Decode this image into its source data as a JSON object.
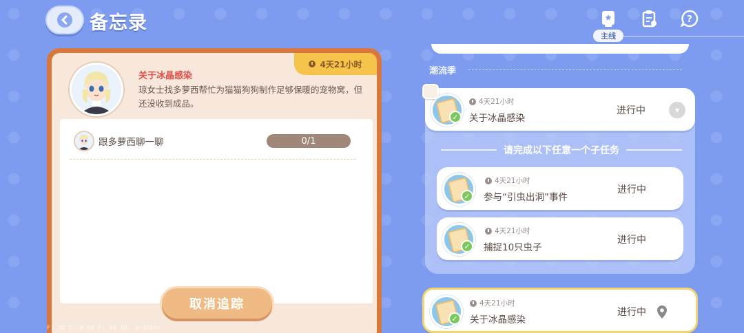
{
  "header": {
    "title": "备忘录",
    "tabs": [
      {
        "icon": "main-quest-icon",
        "label": "主线"
      },
      {
        "icon": "clipboard-icon"
      },
      {
        "icon": "help-icon"
      }
    ]
  },
  "detail": {
    "time_remaining": "4天21小时",
    "quest_title": "关于冰晶感染",
    "quest_desc": "琼女士找多萝西帮忙为猫猫狗狗制作足够保暖的宠物窝，但还没收到成品。",
    "sub_task": {
      "label": "跟多萝西聊一聊",
      "progress": "0/1"
    },
    "untrack_button": "取消追踪"
  },
  "debug_text": "F: 30   T: 0.00   P: 44   ID: qc6h34n",
  "list": {
    "section_title": "潮流季",
    "group": {
      "main": {
        "time": "4天21小时",
        "name": "关于冰晶感染",
        "status": "进行中"
      },
      "subheader": "请完成以下任意一个子任务",
      "subtasks": [
        {
          "time": "4天21小时",
          "name": "参与“引虫出洞”事件",
          "status": "进行中"
        },
        {
          "time": "4天21小时",
          "name": "捕捉10只虫子",
          "status": "进行中"
        }
      ]
    },
    "tracked": {
      "time": "4天21小时",
      "name": "关于冰晶感染",
      "status": "进行中"
    }
  },
  "colors": {
    "background": "#7d9cf0",
    "card_border": "#d9783e",
    "accent_yellow": "#f6c44b",
    "title_red": "#e0514a"
  }
}
